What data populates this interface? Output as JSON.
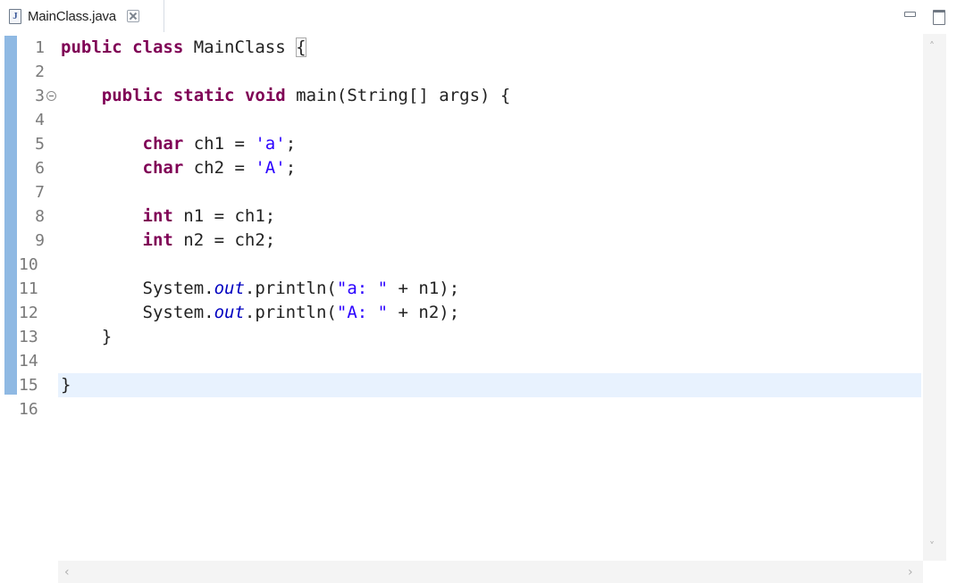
{
  "tab": {
    "file_icon_letter": "J",
    "filename": "MainClass.java"
  },
  "icons": {
    "file": "java-file-icon",
    "close": "close-tab-icon",
    "minimize": "minimize-icon",
    "maximize": "maximize-icon",
    "fold": "fold-collapse-icon"
  },
  "colors": {
    "keyword": "#7f0055",
    "string": "#2a00ff",
    "field": "#0000c0",
    "current_line": "#e8f2fe",
    "change_ruler": "#8fb9e3"
  },
  "editor": {
    "current_line": 15,
    "lines": [
      {
        "num": "1",
        "segments": [
          {
            "t": "kw",
            "v": "public"
          },
          {
            "t": "txt",
            "v": " "
          },
          {
            "t": "kw",
            "v": "class"
          },
          {
            "t": "txt",
            "v": " MainClass "
          },
          {
            "t": "brace",
            "v": "{"
          }
        ]
      },
      {
        "num": "2",
        "segments": []
      },
      {
        "num": "3",
        "fold": true,
        "segments": [
          {
            "t": "txt",
            "v": "    "
          },
          {
            "t": "kw",
            "v": "public"
          },
          {
            "t": "txt",
            "v": " "
          },
          {
            "t": "kw",
            "v": "static"
          },
          {
            "t": "txt",
            "v": " "
          },
          {
            "t": "kw",
            "v": "void"
          },
          {
            "t": "txt",
            "v": " main(String[] args) {"
          }
        ]
      },
      {
        "num": "4",
        "segments": []
      },
      {
        "num": "5",
        "segments": [
          {
            "t": "txt",
            "v": "        "
          },
          {
            "t": "kw",
            "v": "char"
          },
          {
            "t": "txt",
            "v": " ch1 = "
          },
          {
            "t": "str",
            "v": "'a'"
          },
          {
            "t": "txt",
            "v": ";"
          }
        ]
      },
      {
        "num": "6",
        "segments": [
          {
            "t": "txt",
            "v": "        "
          },
          {
            "t": "kw",
            "v": "char"
          },
          {
            "t": "txt",
            "v": " ch2 = "
          },
          {
            "t": "str",
            "v": "'A'"
          },
          {
            "t": "txt",
            "v": ";"
          }
        ]
      },
      {
        "num": "7",
        "segments": []
      },
      {
        "num": "8",
        "segments": [
          {
            "t": "txt",
            "v": "        "
          },
          {
            "t": "kw",
            "v": "int"
          },
          {
            "t": "txt",
            "v": " n1 = ch1;"
          }
        ]
      },
      {
        "num": "9",
        "segments": [
          {
            "t": "txt",
            "v": "        "
          },
          {
            "t": "kw",
            "v": "int"
          },
          {
            "t": "txt",
            "v": " n2 = ch2;"
          }
        ]
      },
      {
        "num": "10",
        "segments": []
      },
      {
        "num": "11",
        "segments": [
          {
            "t": "txt",
            "v": "        System."
          },
          {
            "t": "field",
            "v": "out"
          },
          {
            "t": "txt",
            "v": ".println("
          },
          {
            "t": "str",
            "v": "\"a: \""
          },
          {
            "t": "txt",
            "v": " + n1);"
          }
        ]
      },
      {
        "num": "12",
        "segments": [
          {
            "t": "txt",
            "v": "        System."
          },
          {
            "t": "field",
            "v": "out"
          },
          {
            "t": "txt",
            "v": ".println("
          },
          {
            "t": "str",
            "v": "\"A: \""
          },
          {
            "t": "txt",
            "v": " + n2);"
          }
        ]
      },
      {
        "num": "13",
        "segments": [
          {
            "t": "txt",
            "v": "    }"
          }
        ]
      },
      {
        "num": "14",
        "segments": []
      },
      {
        "num": "15",
        "segments": [
          {
            "t": "txt",
            "v": "}"
          }
        ]
      },
      {
        "num": "16",
        "segments": []
      }
    ]
  },
  "scrollbars": {
    "up": "^",
    "down": "v",
    "left": "<",
    "right": ">"
  }
}
